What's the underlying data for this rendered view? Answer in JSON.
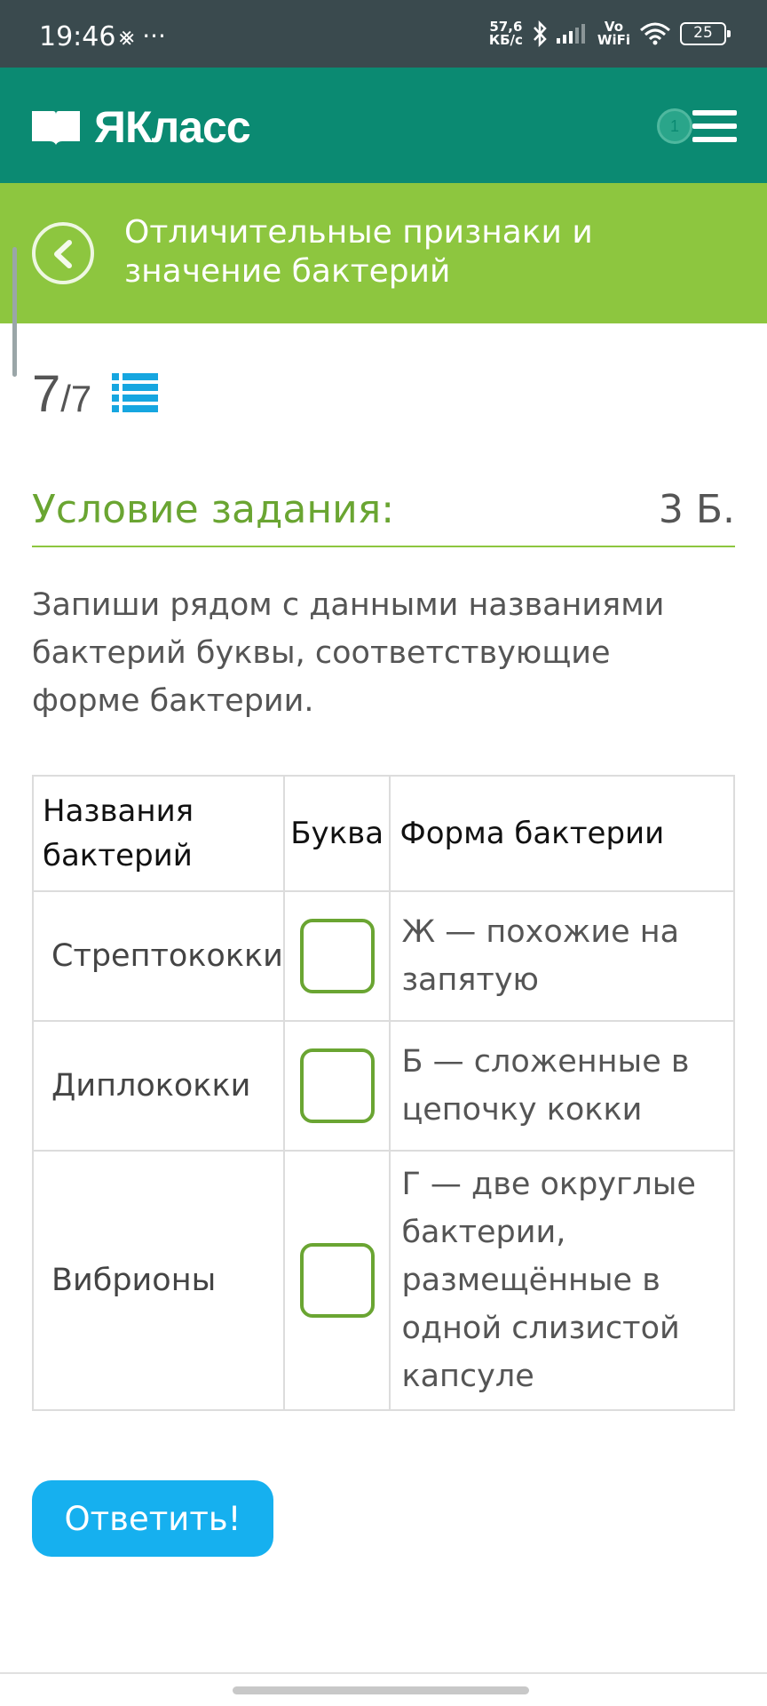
{
  "status_bar": {
    "time": "19:46",
    "left_icons": "⨳ ···",
    "net_speed_value": "57,6",
    "net_speed_unit": "КБ/с",
    "vowifi_top": "Vo",
    "vowifi_bottom": "WiFi",
    "battery": "25"
  },
  "header": {
    "logo_text": "ЯКласс",
    "menu_badge": "1"
  },
  "topic": {
    "title": "Отличительные признаки и значение бактерий"
  },
  "progress": {
    "current": "7",
    "total": "/7"
  },
  "task": {
    "label": "Условие задания:",
    "points": "3 Б.",
    "text": "Запиши рядом с данными названиями бактерий буквы, соответствующие форме бактерии."
  },
  "table": {
    "headers": [
      "Названия бактерий",
      "Буква",
      "Форма бактерии"
    ],
    "rows": [
      {
        "name": "Стрептококки",
        "letter": "",
        "form": "Ж — похожие на запятую"
      },
      {
        "name": "Диплококки",
        "letter": "",
        "form": "Б — сложенные в цепочку кокки"
      },
      {
        "name": "Вибрионы",
        "letter": "",
        "form": "Г — две округлые бактерии, размещённые в одной слизистой капсуле"
      }
    ]
  },
  "submit_label": "Ответить!",
  "colors": {
    "header": "#0b8a72",
    "topic_bar": "#8dc63f",
    "accent_green": "#6aa532",
    "button": "#16b0ef"
  }
}
